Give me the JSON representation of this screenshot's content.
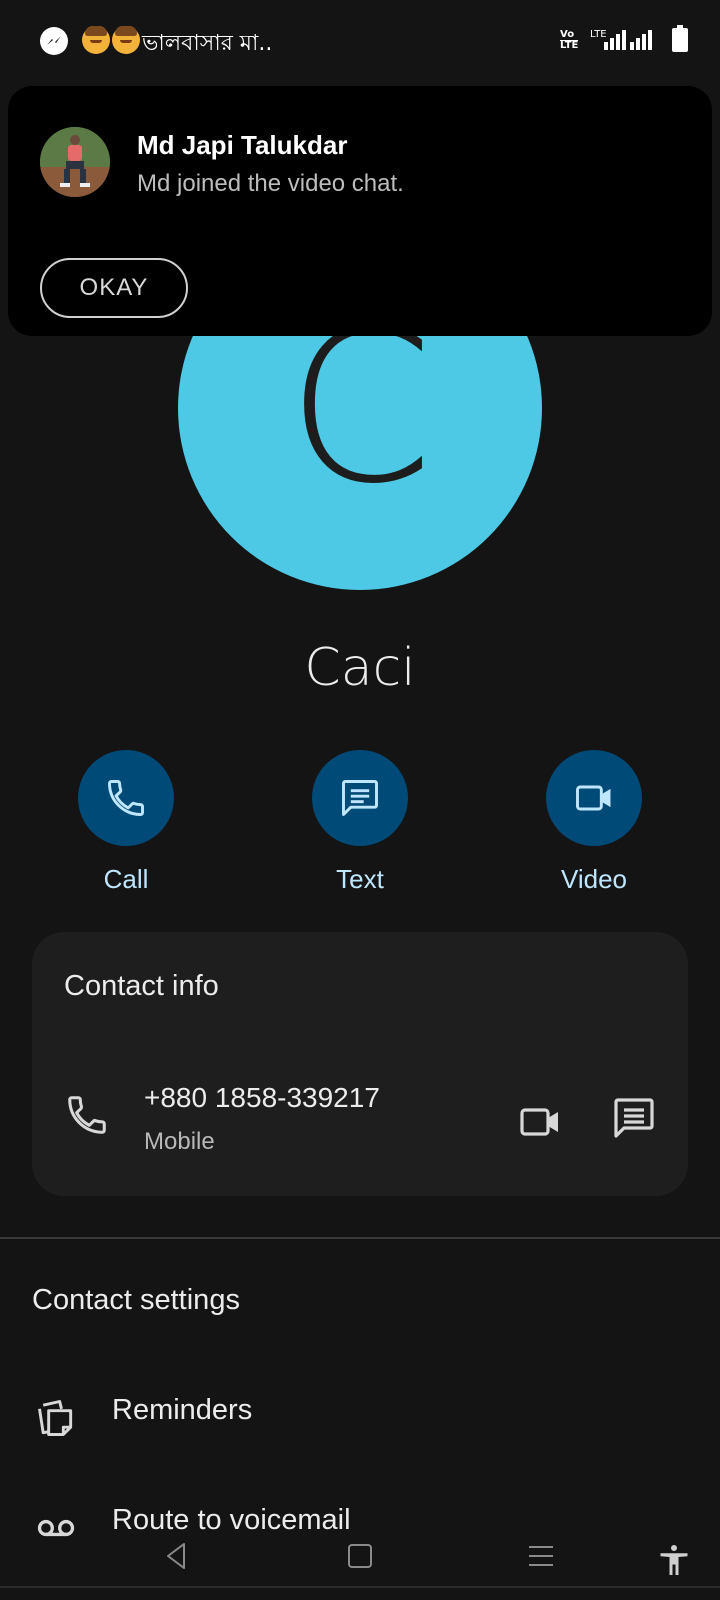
{
  "status_bar": {
    "title": "ভালবাসার মা..",
    "volte_label": "Vo\nLTE",
    "lte_label": "LTE",
    "icons": [
      "messenger-icon",
      "emoji-icon",
      "signal-icon",
      "battery-icon"
    ]
  },
  "notification": {
    "title": "Md Japi Talukdar",
    "body": "Md joined the video chat.",
    "okay_label": "OKAY"
  },
  "contact": {
    "avatar_letter": "C",
    "avatar_color": "#4ec9e5",
    "name": "Caci"
  },
  "actions": [
    {
      "label": "Call",
      "icon": "phone-icon"
    },
    {
      "label": "Text",
      "icon": "message-icon"
    },
    {
      "label": "Video",
      "icon": "video-icon"
    }
  ],
  "contact_info": {
    "title": "Contact info",
    "number": "+880 1858-339217",
    "type": "Mobile"
  },
  "contact_settings": {
    "title": "Contact settings",
    "items": [
      {
        "label": "Reminders",
        "icon": "reminders-icon"
      },
      {
        "label": "Route to voicemail",
        "icon": "voicemail-icon"
      }
    ]
  },
  "colors": {
    "background": "#141414",
    "action_circle": "#004a77",
    "action_label": "#bfe6ff",
    "card": "#1e1e1e"
  }
}
